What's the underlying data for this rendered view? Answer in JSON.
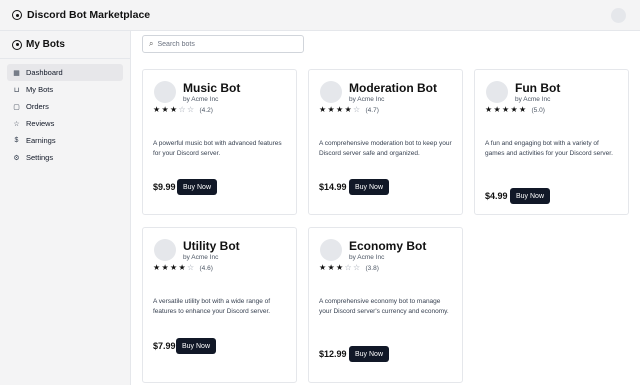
{
  "header": {
    "title": "Discord Bot Marketplace"
  },
  "sidebar": {
    "title": "My Bots",
    "items": [
      {
        "label": "Dashboard",
        "icon": "grid-icon",
        "glyph": "▦",
        "active": true
      },
      {
        "label": "My Bots",
        "icon": "shopping-bag-icon",
        "glyph": "⊔",
        "active": false
      },
      {
        "label": "Orders",
        "icon": "package-icon",
        "glyph": "▢",
        "active": false
      },
      {
        "label": "Reviews",
        "icon": "star-icon",
        "glyph": "☆",
        "active": false
      },
      {
        "label": "Earnings",
        "icon": "dollar-icon",
        "glyph": "$",
        "active": false
      },
      {
        "label": "Settings",
        "icon": "gear-icon",
        "glyph": "⚙",
        "active": false
      }
    ]
  },
  "search": {
    "placeholder": "Search bots",
    "value": ""
  },
  "bots": [
    {
      "name": "Music Bot",
      "author": "by Acme Inc",
      "rating": 3,
      "score": "(4.2)",
      "description": "A powerful music bot with advanced features for your Discord server.",
      "price": "$9.99",
      "buy_label": "Buy Now"
    },
    {
      "name": "Moderation Bot",
      "author": "by Acme Inc",
      "rating": 4,
      "score": "(4.7)",
      "description": "A comprehensive moderation bot to keep your Discord server safe and organized.",
      "price": "$14.99",
      "buy_label": "Buy Now"
    },
    {
      "name": "Fun Bot",
      "author": "by Acme Inc",
      "rating": 5,
      "score": "(5.0)",
      "description": "A fun and engaging bot with a variety of games and activities for your Discord server.",
      "price": "$4.99",
      "buy_label": "Buy Now"
    },
    {
      "name": "Utility Bot",
      "author": "by Acme Inc",
      "rating": 4,
      "score": "(4.6)",
      "description": "A versatile utility bot with a wide range of features to enhance your Discord server.",
      "price": "$7.99",
      "buy_label": "Buy Now"
    },
    {
      "name": "Economy Bot",
      "author": "by Acme Inc",
      "rating": 3,
      "score": "(3.8)",
      "description": "A comprehensive economy bot to manage your Discord server's currency and economy.",
      "price": "$12.99",
      "buy_label": "Buy Now"
    }
  ]
}
